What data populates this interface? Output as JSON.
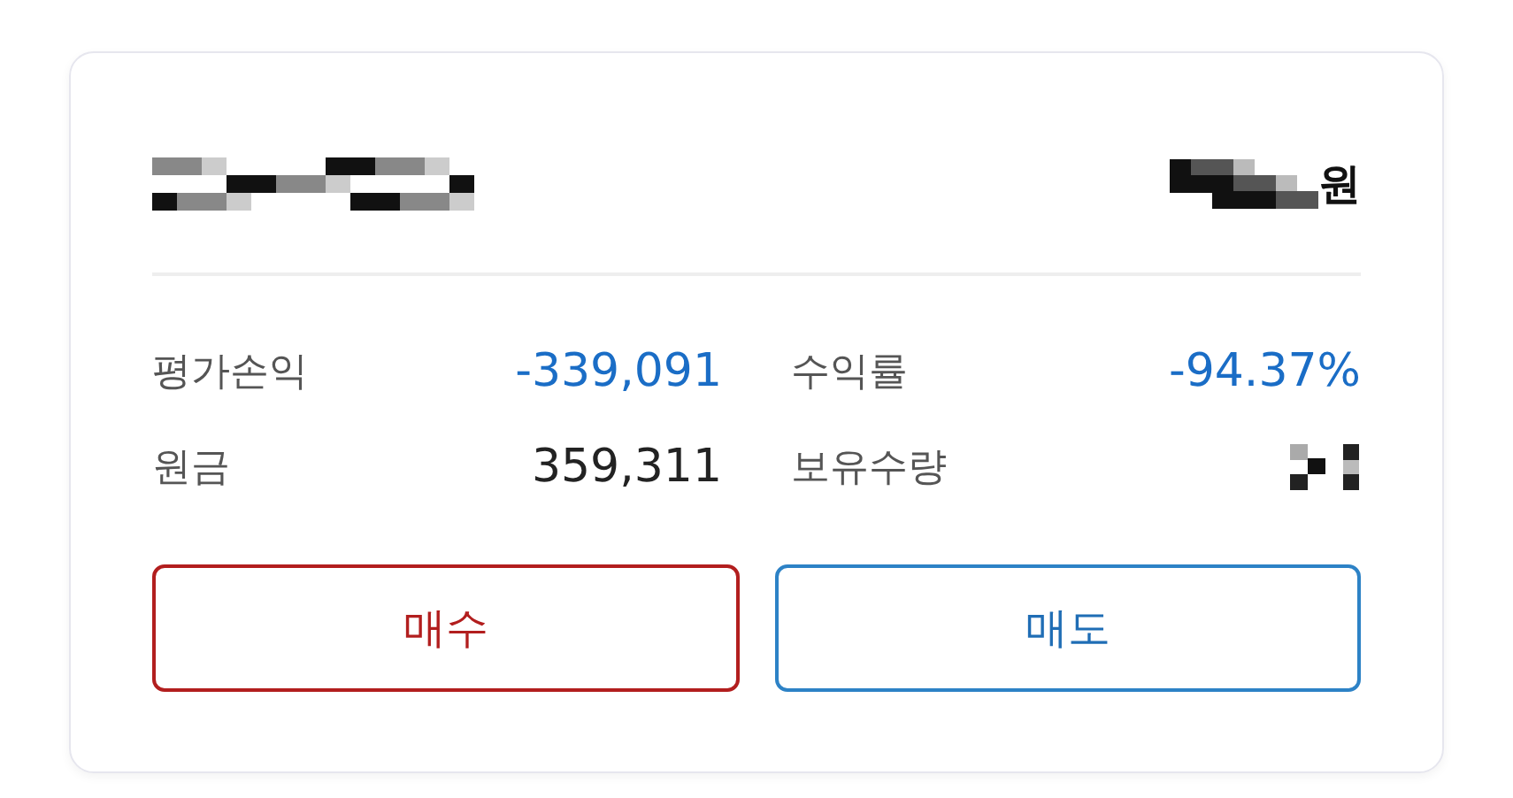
{
  "header": {
    "price_unit": "원"
  },
  "stats": [
    {
      "label": "평가손익",
      "value": "-339,091",
      "color": "#1a6dc6"
    },
    {
      "label": "수익률",
      "value": "-94.37%",
      "color": "#1a6dc6"
    },
    {
      "label": "원금",
      "value": "359,311",
      "color": "#222222"
    },
    {
      "label": "보유수량",
      "redacted": true
    }
  ],
  "buttons": [
    {
      "label": "매수",
      "kind": "buy"
    },
    {
      "label": "매도",
      "kind": "sell"
    }
  ]
}
